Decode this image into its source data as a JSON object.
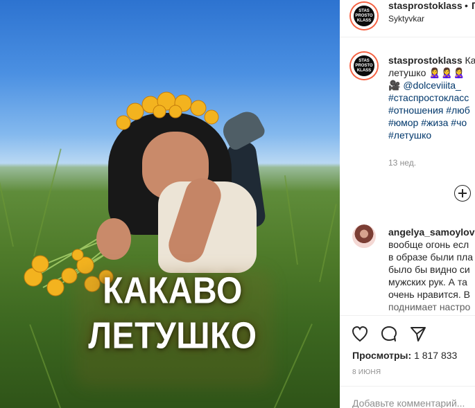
{
  "media": {
    "overlay_text_line1": "КАКАВО",
    "overlay_text_line2": "ЛЕТУШКО",
    "colors": {
      "sky_top": "#2d73d0",
      "grass": "#4f7b2a",
      "flower": "#f3b31f",
      "text": "#ffffff"
    }
  },
  "header": {
    "avatar_icon": "profile-avatar-icon",
    "avatar_text": "STAS PROSTO KLASS",
    "username": "stasprostoklass",
    "separator": "•",
    "follow_partial": "П",
    "location": "Syktyvkar"
  },
  "post": {
    "username": "stasprostoklass",
    "caption_start": "Ка",
    "caption_line2": "летушко 🙎‍♀️🙎‍♀️🙎‍♀️",
    "mention_emoji": "🎥",
    "mention": "@dolceviiita_",
    "tags": [
      "#стаспростокласс",
      "#отношения #люб",
      "#юмор #жиза #чо",
      "#летушко"
    ],
    "timestamp": "13 нед.",
    "add_icon": "plus-circle-icon"
  },
  "comment": {
    "avatar_icon": "comment-avatar-icon",
    "username": "angelya_samoylova",
    "lines": [
      "вообще огонь есл",
      "в образе были пла",
      "было бы видно си",
      "мужских рук. А та",
      "очень нравится. В",
      "поднимает настро"
    ]
  },
  "actions": {
    "like_icon": "heart-icon",
    "comment_icon": "comment-bubble-icon",
    "share_icon": "paper-plane-icon",
    "views_label": "Просмотры:",
    "views_count": "1 817 833",
    "date": "8 ИЮНЯ",
    "comment_placeholder": "Добавьте комментарий..."
  }
}
